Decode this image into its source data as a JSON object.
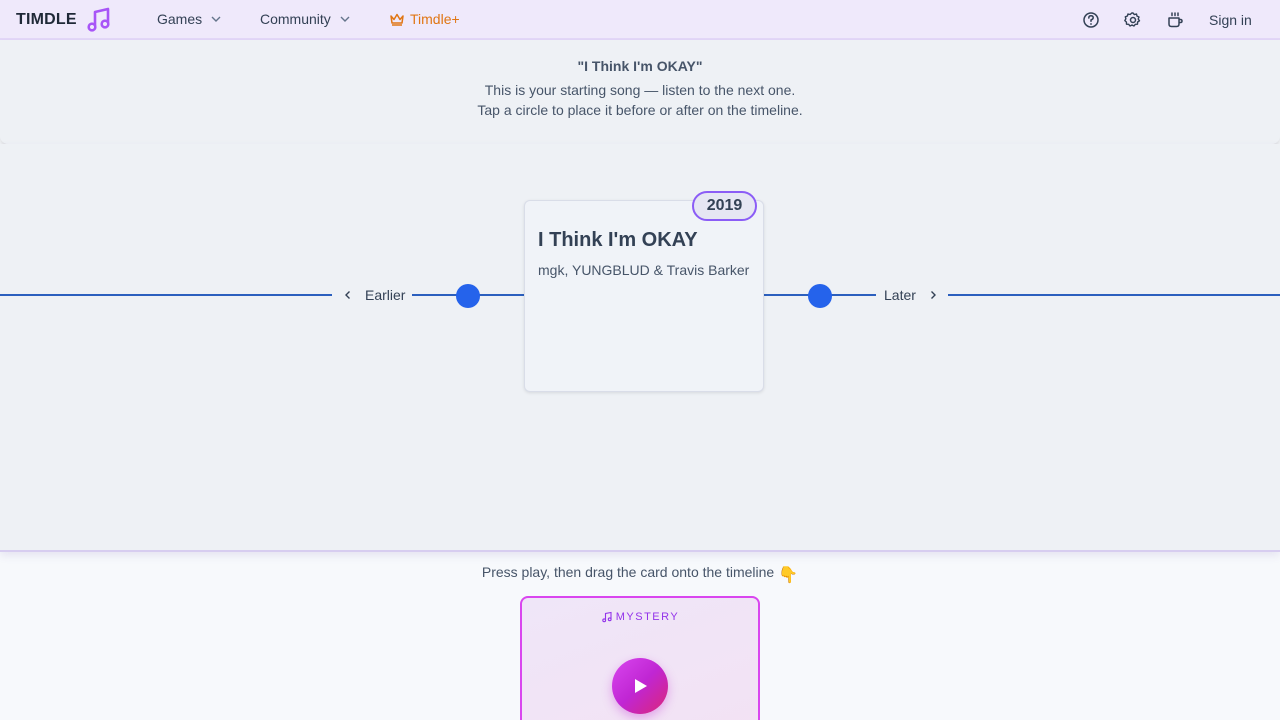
{
  "nav": {
    "brand": "TIMDLE",
    "games_label": "Games",
    "community_label": "Community",
    "plus_label": "Timdle+",
    "signin_label": "Sign in",
    "icons": [
      "music-note-icon",
      "chevron-down-icon",
      "crown-icon",
      "help-circle-icon",
      "gear-icon",
      "coffee-cup-icon"
    ]
  },
  "info": {
    "title": "\"I Think I'm OKAY\"",
    "line1": "This is your starting song — listen to the next one.",
    "line2": "Tap a circle to place it before or after on the timeline."
  },
  "timeline": {
    "earlier_label": "Earlier",
    "later_label": "Later",
    "card": {
      "year": "2019",
      "title": "I Think I'm OKAY",
      "artist": "mgk, YUNGBLUD & Travis Barker"
    }
  },
  "bottom": {
    "hint": "Press play, then drag the card onto the timeline",
    "hint_emoji": "👇",
    "mystery_label": "MYSTERY"
  },
  "colors": {
    "accent_purple": "#8b5cf6",
    "timeline_blue": "#2563eb",
    "plus_orange": "#e07614",
    "mystery_magenta": "#d946ef"
  }
}
